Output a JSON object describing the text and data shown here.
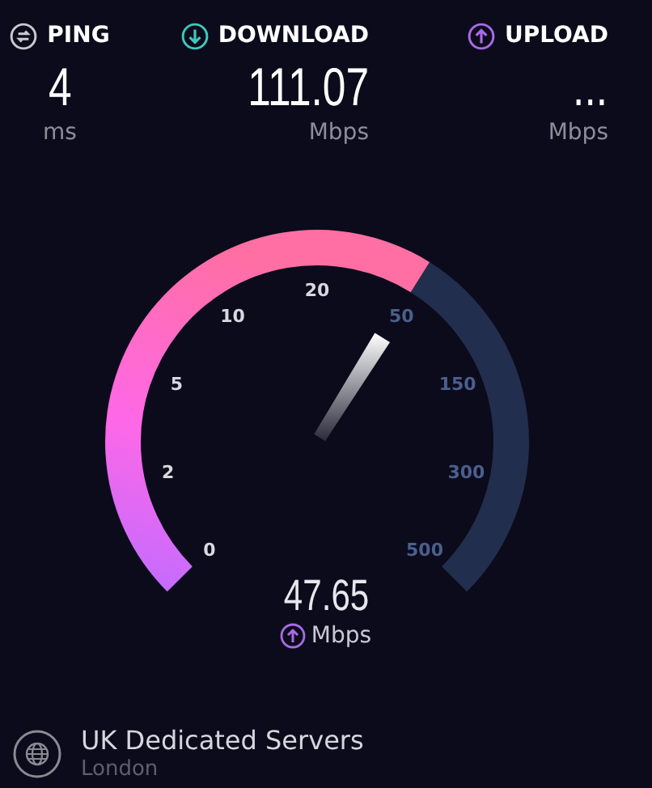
{
  "metrics": [
    {
      "kind": "ping",
      "label": "PING",
      "value": "4",
      "unit": "ms"
    },
    {
      "kind": "download",
      "label": "DOWNLOAD",
      "value": "111.07",
      "unit": "Mbps"
    },
    {
      "kind": "upload",
      "label": "UPLOAD",
      "value": "...",
      "unit": "Mbps"
    }
  ],
  "gauge": {
    "ticks": [
      {
        "label": "0",
        "on": true
      },
      {
        "label": "2",
        "on": true
      },
      {
        "label": "5",
        "on": true
      },
      {
        "label": "10",
        "on": true
      },
      {
        "label": "20",
        "on": true
      },
      {
        "label": "50",
        "on": false
      },
      {
        "label": "150",
        "on": false
      },
      {
        "label": "300",
        "on": false
      },
      {
        "label": "500",
        "on": false
      }
    ],
    "reading": "47.65",
    "unit": "Mbps"
  },
  "server": {
    "name": "UK Dedicated Servers",
    "location": "London"
  }
}
